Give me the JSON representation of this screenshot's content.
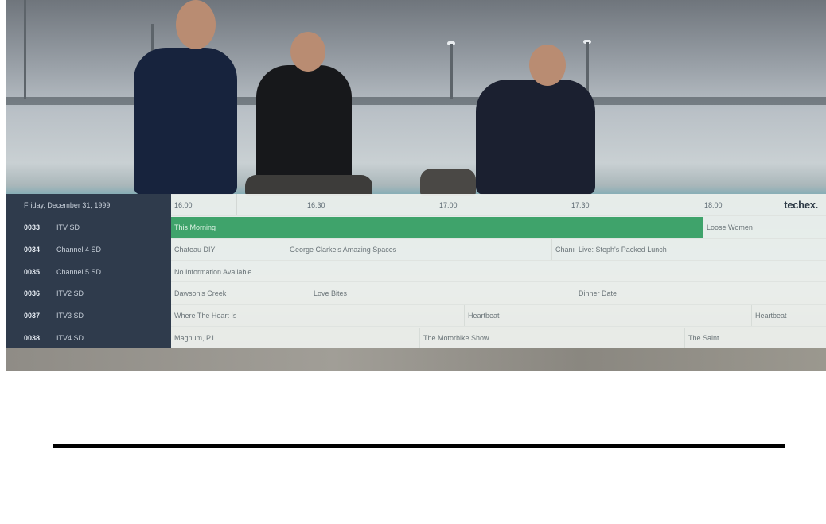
{
  "epg": {
    "date": "Friday, December 31, 1999",
    "logo": "techex.",
    "times": [
      "16:00",
      "16:30",
      "17:00",
      "17:30",
      "18:00"
    ],
    "channels": [
      {
        "number": "0033",
        "name": "ITV SD"
      },
      {
        "number": "0034",
        "name": "Channel 4 SD"
      },
      {
        "number": "0035",
        "name": "Channel 5 SD"
      },
      {
        "number": "0036",
        "name": "ITV2 SD"
      },
      {
        "number": "0037",
        "name": "ITV3 SD"
      },
      {
        "number": "0038",
        "name": "ITV4 SD"
      }
    ],
    "programmes": [
      [
        {
          "title": "This Morning",
          "active": true
        },
        {
          "title": "Loose Women"
        }
      ],
      [
        {
          "title": "Chateau DIY"
        },
        {
          "title": "George Clarke's Amazing Spaces"
        },
        {
          "title": "Chanı"
        },
        {
          "title": "Live: Steph's Packed Lunch"
        }
      ],
      [
        {
          "title": "No Information Available"
        }
      ],
      [
        {
          "title": "Dawson's Creek"
        },
        {
          "title": "Love Bites"
        },
        {
          "title": "Dinner Date"
        }
      ],
      [
        {
          "title": "Where The Heart Is"
        },
        {
          "title": "Heartbeat"
        },
        {
          "title": "Heartbeat"
        }
      ],
      [
        {
          "title": "Magnum, P.I."
        },
        {
          "title": "The Motorbike Show"
        },
        {
          "title": "The Saint"
        }
      ]
    ],
    "accent_color": "#3fa36b"
  }
}
